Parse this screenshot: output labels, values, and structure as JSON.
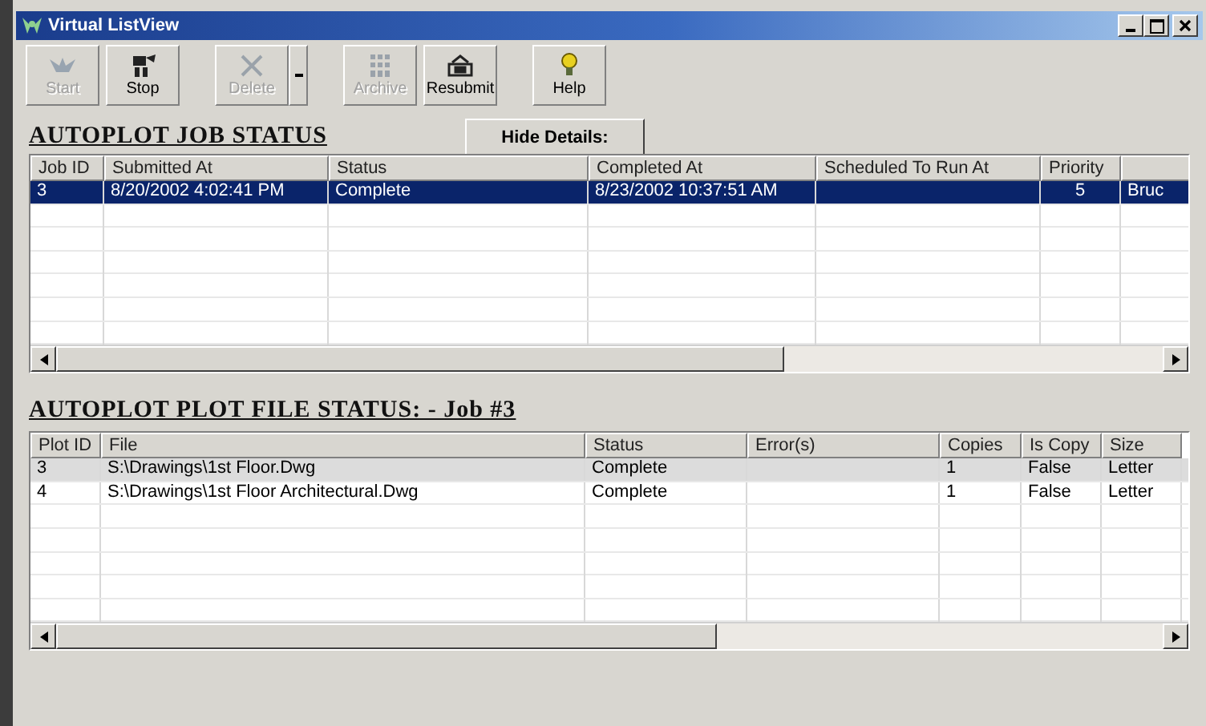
{
  "window": {
    "title": "Virtual ListView"
  },
  "toolbar": [
    {
      "label": "Start",
      "kind": "start",
      "disabled": true,
      "has_menu": false
    },
    {
      "label": "Stop",
      "kind": "stop",
      "disabled": false,
      "has_menu": false
    },
    {
      "label": "Delete",
      "kind": "delete",
      "disabled": true,
      "has_menu": true
    },
    {
      "label": "Archive",
      "kind": "archive",
      "disabled": true,
      "has_menu": false
    },
    {
      "label": "Resubmit",
      "kind": "resubmit",
      "disabled": false,
      "has_menu": false
    },
    {
      "label": "Help",
      "kind": "help",
      "disabled": false,
      "has_menu": false
    }
  ],
  "job_section": {
    "heading": "AUTOPLOT JOB STATUS",
    "toggle_button": "Hide Details:",
    "table": {
      "has_focus": true,
      "columns": [
        "Job ID",
        "Submitted At",
        "Status",
        "Completed At",
        "Scheduled To Run At",
        "Priority",
        ""
      ],
      "rows": [
        {
          "selected": true,
          "cells": [
            "3",
            "8/20/2002 4:02:41 PM",
            "Complete",
            "8/23/2002 10:37:51 AM",
            "",
            "5",
            "Bruc"
          ]
        }
      ]
    }
  },
  "plot_section": {
    "heading": "AUTOPLOT PLOT FILE STATUS: - Job #3",
    "table": {
      "has_focus": false,
      "columns": [
        "Plot ID",
        "File",
        "Status",
        "Error(s)",
        "Copies",
        "Is Copy",
        "Size"
      ],
      "rows": [
        {
          "selected": true,
          "cells": [
            "3",
            "S:\\Drawings\\1st Floor.Dwg",
            "Complete",
            "",
            "1",
            "False",
            "Letter"
          ]
        },
        {
          "selected": false,
          "cells": [
            "4",
            "S:\\Drawings\\1st Floor Architectural.Dwg",
            "Complete",
            "",
            "1",
            "False",
            "Letter"
          ]
        }
      ]
    }
  }
}
